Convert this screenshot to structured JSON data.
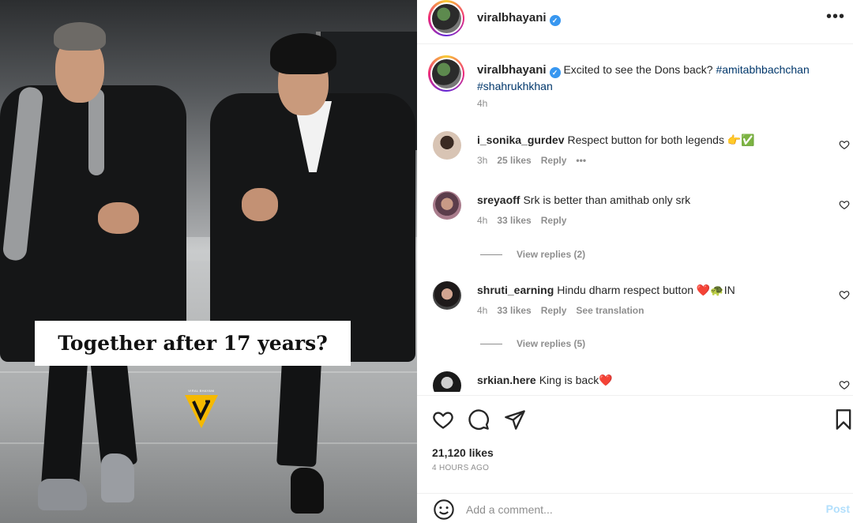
{
  "media": {
    "caption_overlay": "Together after 17 years?",
    "logo_small_text": "VIRAL BHAYANI"
  },
  "header": {
    "username": "viralbhayani",
    "more_icon": "more-horizontal-icon"
  },
  "caption": {
    "username": "viralbhayani",
    "text": "Excited to see the Dons back?",
    "hashtags": [
      "#amitabhbachchan",
      "#shahrukhkhan"
    ],
    "time": "4h"
  },
  "comments": [
    {
      "username": "i_sonika_gurdev",
      "text": "Respect button for both legends 👉✅",
      "time": "3h",
      "likes": "25 likes",
      "reply": "Reply",
      "extra": "•••",
      "view_replies": ""
    },
    {
      "username": "sreyaoff",
      "text": "Srk is better than amithab only srk",
      "time": "4h",
      "likes": "33 likes",
      "reply": "Reply",
      "extra": "",
      "view_replies": "View replies (2)"
    },
    {
      "username": "shruti_earning",
      "text": "Hindu dharm respect button ❤️🐢IN",
      "time": "4h",
      "likes": "33 likes",
      "reply": "Reply",
      "extra": "See translation",
      "view_replies": "View replies (5)"
    },
    {
      "username": "srkian.here",
      "text": "King is back❤️",
      "time": "",
      "likes": "",
      "reply": "",
      "extra": "",
      "view_replies": ""
    }
  ],
  "actions": {
    "likes_count": "21,120 likes",
    "posted_time": "4 HOURS AGO"
  },
  "add_comment": {
    "placeholder": "Add a comment...",
    "post_label": "Post"
  },
  "colors": {
    "accent_link": "#00376b",
    "verified": "#3897f0",
    "muted": "#8e8e8e"
  }
}
